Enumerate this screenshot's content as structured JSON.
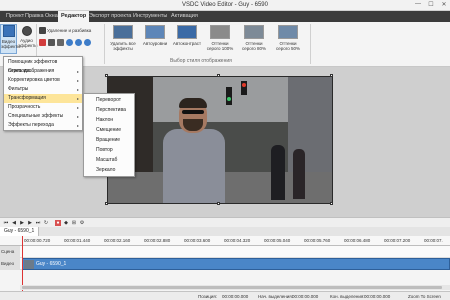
{
  "window": {
    "title": "VSDC Video Editor - Guy - 6590",
    "controls": [
      "—",
      "☐",
      "✕"
    ]
  },
  "menu": {
    "items": [
      "Проект",
      "Правка",
      "Окна",
      "Редактор",
      "Экспорт проекта",
      "Инструменты",
      "Активация"
    ],
    "active": "Редактор"
  },
  "ribbon": {
    "effects_button": "Видео эффекты",
    "audio_button": "Аудио эффекты",
    "delete_split_label": "Удаление и разбивка",
    "quick_styles": [
      {
        "label": "Удалить все эффекты"
      },
      {
        "label": "Автоуровни"
      },
      {
        "label": "Автоконтраст"
      },
      {
        "label": "Оттенки серого 100%"
      },
      {
        "label": "Оттенки серого 80%"
      },
      {
        "label": "Оттенки серого 50%"
      }
    ],
    "group_quick_styles": "Выбор стиля отображения"
  },
  "context_menu": {
    "items": [
      {
        "label": "Помощник эффектов перехода...",
        "arrow": false
      },
      {
        "label": "Стиль изображения",
        "arrow": true
      },
      {
        "label": "Корректировка цветов",
        "arrow": true
      },
      {
        "label": "Фильтры",
        "arrow": true
      },
      {
        "label": "Трансформация",
        "arrow": true,
        "highlighted": true
      },
      {
        "label": "Прозрачность",
        "arrow": true
      },
      {
        "label": "Специальные эффекты",
        "arrow": true
      },
      {
        "label": "Эффекты перехода",
        "arrow": true
      }
    ],
    "submenu": [
      "Переворот",
      "Перспектива",
      "Наклон",
      "Смещение",
      "Вращение",
      "Повтор",
      "Масштаб",
      "Зеркало"
    ]
  },
  "timeline": {
    "tab": "Guy - 6590_1",
    "ruler": [
      "00:00:00.720",
      "00:00:01.440",
      "00:00:02.160",
      "00:00:02.880",
      "00:00:03.600",
      "00:00:04.320",
      "00:00:05.040",
      "00:00:05.760",
      "00:00:06.480",
      "00:00:07.200",
      "00:00:07."
    ],
    "tracks": [
      {
        "label": "Сцена"
      },
      {
        "label": "Видео"
      }
    ],
    "clip_label": "Guy - 6590_1"
  },
  "status": {
    "position_label": "Позиция:",
    "position_value": "00:00:00.000",
    "sel_start_label": "Нач. выделения:",
    "sel_start_value": "00:00:00.000",
    "sel_end_label": "Кон. выделения:",
    "sel_end_value": "00:00:00.000",
    "zoom_label": "Zoom To Screen"
  }
}
